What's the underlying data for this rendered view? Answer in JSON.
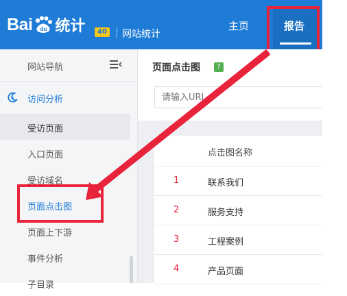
{
  "header": {
    "logo_left": "Bai",
    "logo_paw_text": "du",
    "logo_cn": "统计",
    "badge": "40",
    "subtitle": "网站统计",
    "nav_home": "主页",
    "nav_report": "报告"
  },
  "sidebar": {
    "title": "网站导航",
    "group": "访问分析",
    "items": [
      {
        "label": "受访页面",
        "state": "selected"
      },
      {
        "label": "入口页面",
        "state": "normal"
      },
      {
        "label": "受访域名",
        "state": "normal"
      },
      {
        "label": "页面点击图",
        "state": "active"
      },
      {
        "label": "页面上下游",
        "state": "normal"
      },
      {
        "label": "事件分析",
        "state": "normal"
      },
      {
        "label": "子目录",
        "state": "normal"
      }
    ]
  },
  "main": {
    "title": "页面点击图",
    "help_label": "?",
    "search_placeholder": "请输入URL...",
    "table_header": "点击图名称",
    "rows": [
      {
        "num": "1",
        "name": "联系我们"
      },
      {
        "num": "2",
        "name": "服务支持"
      },
      {
        "num": "3",
        "name": "工程案例"
      },
      {
        "num": "4",
        "name": "产品页面"
      }
    ]
  },
  "colors": {
    "brand_blue": "#1e7bd6",
    "highlight_red": "#e8233a",
    "badge_yellow": "#f5c518",
    "help_green": "#52b050"
  }
}
